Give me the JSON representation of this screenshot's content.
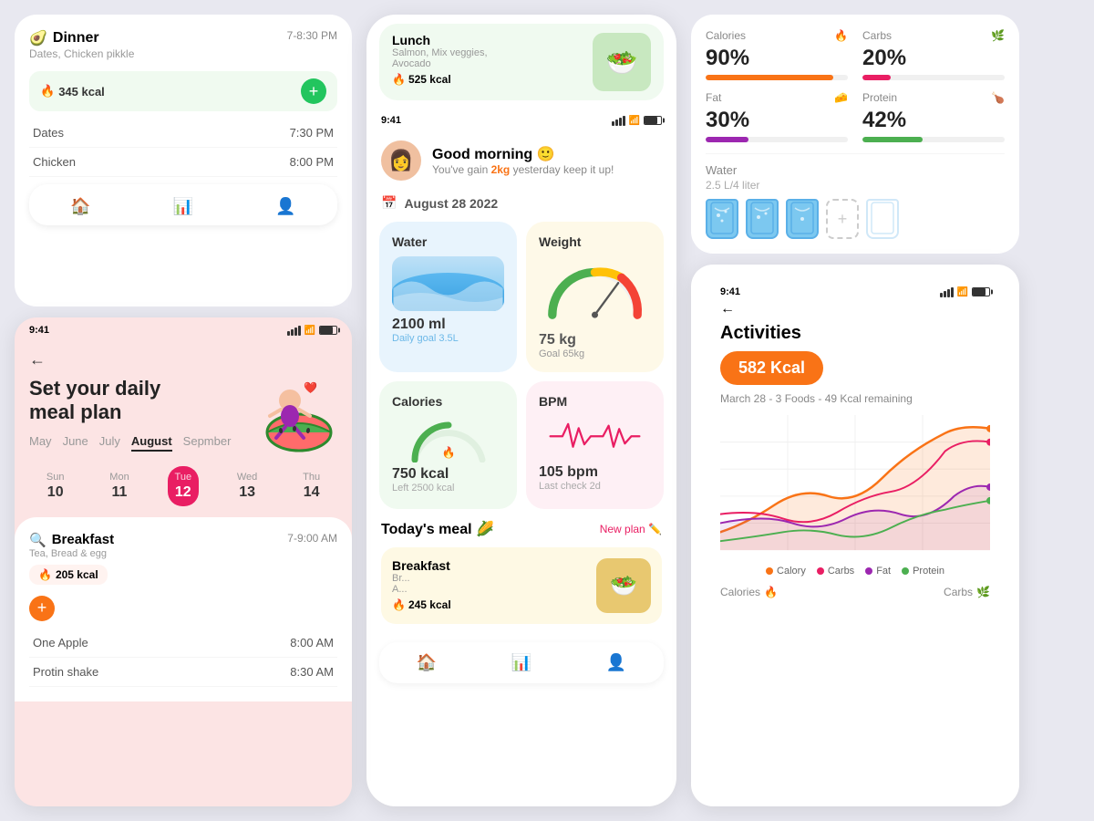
{
  "app": {
    "status_time": "9:41",
    "greeting": "Good morning 🙂",
    "greeting_sub_pre": "You've gain ",
    "greeting_gain": "2kg",
    "greeting_sub_post": " yesterday keep it up!",
    "date_display": "August 28 2022",
    "avatar_emoji": "👩"
  },
  "left_top": {
    "dinner_emoji": "🥑",
    "dinner_label": "Dinner",
    "dinner_time": "7-8:30 PM",
    "dinner_desc": "Dates, Chicken pikkle",
    "dinner_kcal": "345 kcal",
    "food_items": [
      {
        "name": "Dates",
        "time": "7:30 PM"
      },
      {
        "name": "Chicken",
        "time": "8:00 PM"
      }
    ]
  },
  "meal_plan": {
    "time": "9:41",
    "back": "←",
    "title": "Set your daily\nmeal plan",
    "months": [
      "May",
      "June",
      "July",
      "August",
      "Sepmber"
    ],
    "active_month": "August",
    "days": [
      {
        "name": "Sun",
        "num": "10",
        "active": false
      },
      {
        "name": "Mon",
        "num": "11",
        "active": false
      },
      {
        "name": "Tue",
        "num": "12",
        "active": true
      },
      {
        "name": "Wed",
        "num": "13",
        "active": false
      },
      {
        "name": "Thu",
        "num": "14",
        "active": false
      }
    ],
    "breakfast_icon": "🔍",
    "breakfast_label": "Breakfast",
    "breakfast_time": "7-9:00 AM",
    "breakfast_desc": "Tea, Bread & egg",
    "breakfast_kcal": "205 kcal",
    "food_items": [
      {
        "name": "One Apple",
        "time": "8:00 AM"
      },
      {
        "name": "Protin shake",
        "time": "8:30 AM"
      }
    ]
  },
  "widgets": {
    "water_label": "Water",
    "water_value": "2100 ml",
    "water_goal": "Daily goal 3.5L",
    "weight_label": "Weight",
    "weight_value": "75 kg",
    "weight_goal": "Goal 65kg",
    "calories_label": "Calories",
    "calories_value": "750 kcal",
    "calories_left": "Left 2500 kcal",
    "bpm_label": "BPM",
    "bpm_value": "105 bpm",
    "bpm_last": "Last check 2d"
  },
  "today_meal": {
    "title": "Today's meal 🌽",
    "new_plan": "New plan ✏️",
    "breakfast_title": "Breakfast",
    "breakfast_desc": "Br...\nA...",
    "breakfast_kcal": "245 kcal"
  },
  "lunch_top": {
    "label": "Lunch",
    "desc": "Salmon, Mix veggies,\nAvocado",
    "kcal": "525 kcal"
  },
  "nutrition": {
    "calories_label": "Calories",
    "calories_pct": "90%",
    "calories_progress": 90,
    "calories_color": "#f97316",
    "carbs_label": "Carbs",
    "carbs_pct": "20%",
    "carbs_progress": 20,
    "carbs_color": "#e91e63",
    "fat_label": "Fat",
    "fat_pct": "30%",
    "fat_progress": 30,
    "fat_color": "#9c27b0",
    "protein_label": "Protein",
    "protein_pct": "42%",
    "protein_progress": 42,
    "protein_color": "#4caf50",
    "water_title": "Water",
    "water_amount": "2.5 L/4 liter",
    "glasses": [
      true,
      true,
      true,
      false,
      false
    ]
  },
  "activities": {
    "time": "9:41",
    "title": "Activities",
    "kcal_value": "582 Kcal",
    "meta": "March 28 -  3 Foods -  49 Kcal remaining",
    "legend": [
      {
        "label": "Calory",
        "color": "#f97316"
      },
      {
        "label": "Carbs",
        "color": "#e91e63"
      },
      {
        "label": "Fat",
        "color": "#9c27b0"
      },
      {
        "label": "Protein",
        "color": "#4caf50"
      }
    ],
    "bottom_labels": [
      "Calories",
      "Carbs"
    ]
  },
  "nav": {
    "home_icon": "🏠",
    "chart_icon": "📊",
    "user_icon": "👤"
  }
}
